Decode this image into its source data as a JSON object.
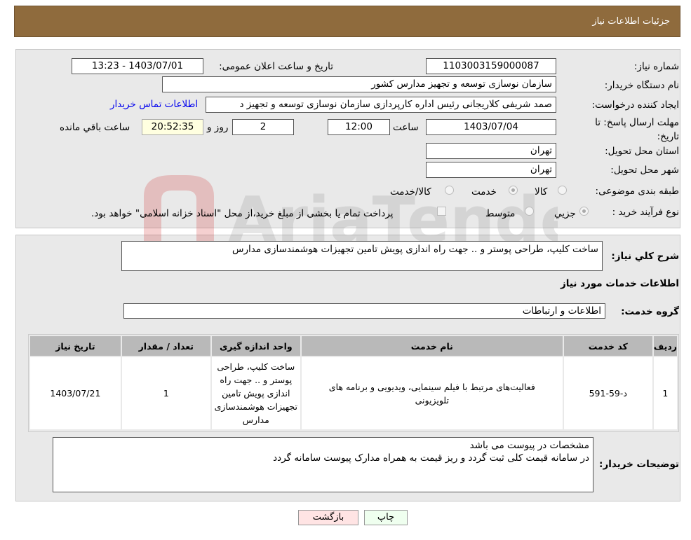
{
  "header": {
    "title": "جزئیات اطلاعات نیاز"
  },
  "form": {
    "need_number_label": "شماره نیاز:",
    "need_number": "1103003159000087",
    "announce_label": "تاریخ و ساعت اعلان عمومی:",
    "announce_value": "1403/07/01 - 13:23",
    "buyer_label": "نام دستگاه خریدار:",
    "buyer_value": "سازمان نوسازی  توسعه و تجهیز مدارس کشور",
    "requester_label": "ایجاد کننده درخواست:",
    "requester_value": "صمد شریفی کلاریجانی رئیس اداره کارپردازی سازمان نوسازی  توسعه و تجهیز د",
    "contact_link": "اطلاعات تماس خریدار",
    "deadline_label": "مهلت ارسال پاسخ: تا تاریخ:",
    "deadline_date": "1403/07/04",
    "time_label": "ساعت",
    "deadline_time": "12:00",
    "days": "2",
    "days_label": "روز و",
    "remaining": "20:52:35",
    "remaining_label": "ساعت باقي مانده",
    "province_label": "استان محل تحویل:",
    "province": "تهران",
    "city_label": "شهر محل تحویل:",
    "city": "تهران",
    "category_label": "طبقه بندی موضوعی:",
    "category_options": [
      "کالا",
      "خدمت",
      "کالا/خدمت"
    ],
    "category_selected": "خدمت",
    "process_label": "نوع فرآیند خرید :",
    "process_options": [
      "جزيي",
      "متوسط"
    ],
    "process_selected": "جزيي",
    "process_note": "پرداخت تمام یا بخشی از مبلغ خرید،از محل \"اسناد خزانه اسلامی\" خواهد بود."
  },
  "details": {
    "desc_label": "شرح کلي نياز:",
    "desc_value": "ساخت کلیپ، طراحی پوستر و .. جهت راه اندازی پویش تامین تجهیزات هوشمندسازی مدارس",
    "section_title": "اطلاعات خدمات مورد نیاز",
    "group_label": "گروه خدمت:",
    "group_value": "اطلاعات و ارتباطات",
    "table": {
      "headers": [
        "ردیف",
        "کد خدمت",
        "نام خدمت",
        "واحد اندازه گیری",
        "تعداد / مقدار",
        "تاریخ نیاز"
      ],
      "rows": [
        [
          "1",
          "د-59-591",
          "فعالیت‌های مرتبط با فیلم سینمایی، ویدیویی و برنامه های تلویزیونی",
          "ساخت کلیپ، طراحی پوستر و .. جهت راه اندازی پویش تامین تجهیزات هوشمندسازی مدارس",
          "1",
          "1403/07/21"
        ]
      ]
    },
    "notes_label": "توضیحات خریدار:",
    "notes_line1": "مشخصات در پیوست می باشد",
    "notes_line2": "در سامانه قیمت کلی ثبت گردد و ریز قیمت به همراه مدارک پیوست سامانه گردد"
  },
  "buttons": {
    "print": "چاپ",
    "back": "بازگشت"
  },
  "watermark": "AriaTender.neT",
  "colors": {
    "header": "#8f6b3d",
    "link": "#0000ee",
    "remaining_bg": "#ffffe0",
    "print_bg": "#efffef",
    "back_bg": "#ffe4e4"
  }
}
